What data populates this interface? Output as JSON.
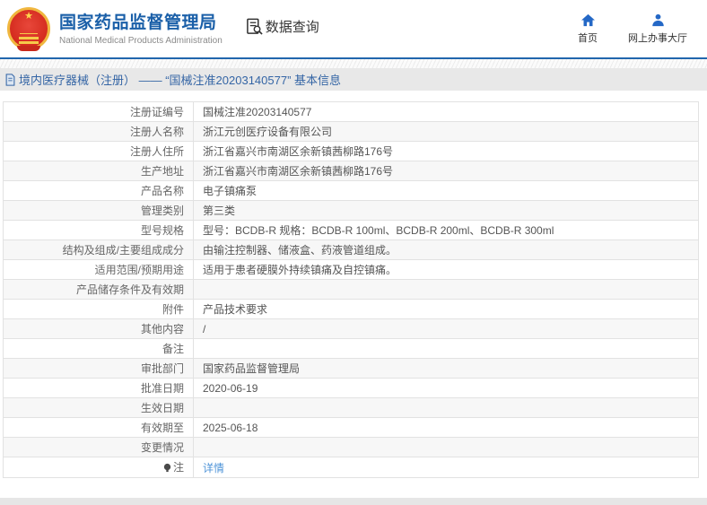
{
  "header": {
    "title": "国家药品监督管理局",
    "subtitle": "National Medical Products Administration",
    "section_label": "数据查询",
    "nav": [
      {
        "label": "首页",
        "icon": "home-icon"
      },
      {
        "label": "网上办事大厅",
        "icon": "user-icon"
      }
    ]
  },
  "breadcrumb": {
    "text": "境内医疗器械（注册） —— “国械注准20203140577” 基本信息"
  },
  "detail_table": {
    "rows": [
      {
        "label": "注册证编号",
        "value": "国械注准20203140577"
      },
      {
        "label": "注册人名称",
        "value": "浙江元创医疗设备有限公司"
      },
      {
        "label": "注册人住所",
        "value": "浙江省嘉兴市南湖区余新镇茜柳路176号"
      },
      {
        "label": "生产地址",
        "value": "浙江省嘉兴市南湖区余新镇茜柳路176号"
      },
      {
        "label": "产品名称",
        "value": "电子镇痛泵"
      },
      {
        "label": "管理类别",
        "value": "第三类"
      },
      {
        "label": "型号规格",
        "value": "型号：BCDB-R 规格：BCDB-R 100ml、BCDB-R 200ml、BCDB-R 300ml"
      },
      {
        "label": "结构及组成/主要组成成分",
        "value": "由输注控制器、储液盒、药液管道组成。"
      },
      {
        "label": "适用范围/预期用途",
        "value": "适用于患者硬膜外持续镇痛及自控镇痛。"
      },
      {
        "label": "产品储存条件及有效期",
        "value": ""
      },
      {
        "label": "附件",
        "value": "产品技术要求"
      },
      {
        "label": "其他内容",
        "value": "/"
      },
      {
        "label": "备注",
        "value": ""
      },
      {
        "label": "审批部门",
        "value": "国家药品监督管理局"
      },
      {
        "label": "批准日期",
        "value": "2020-06-19"
      },
      {
        "label": "生效日期",
        "value": ""
      },
      {
        "label": "有效期至",
        "value": "2025-06-18"
      },
      {
        "label": "变更情况",
        "value": ""
      },
      {
        "label": "注",
        "value": "详情",
        "value_is_link": true,
        "label_icon": "note-icon"
      }
    ]
  },
  "colors": {
    "brand_blue": "#1a5fa8",
    "header_line_blue": "#2166ad",
    "nav_icon_blue": "#2468c6",
    "breadcrumb_text_blue": "#3465a5",
    "link_blue": "#4f94d8",
    "row_stripe_gray": "#f7f7f7"
  }
}
